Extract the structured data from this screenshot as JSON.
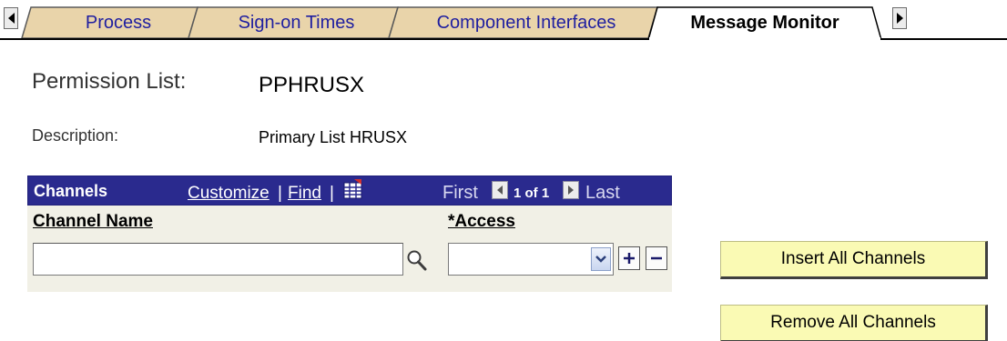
{
  "tabs": [
    {
      "label": "Process",
      "active": false
    },
    {
      "label": "Sign-on Times",
      "active": false
    },
    {
      "label": "Component Interfaces",
      "active": false
    },
    {
      "label": "Message Monitor",
      "active": true
    }
  ],
  "fields": {
    "permission_list_label": "Permission List:",
    "permission_list_value": "PPHRUSX",
    "description_label": "Description:",
    "description_value": "Primary List HRUSX"
  },
  "grid": {
    "title": "Channels",
    "customize_link": "Customize",
    "find_link": "Find",
    "separator": "|",
    "nav_first": "First",
    "nav_count": "1 of 1",
    "nav_last": "Last",
    "columns": [
      "Channel Name",
      "*Access"
    ],
    "row": {
      "channel_name": "",
      "access": ""
    }
  },
  "buttons": {
    "insert_all": "Insert All Channels",
    "remove_all": "Remove All Channels"
  },
  "colors": {
    "grid_header": "#2a2a8e",
    "tab_inactive": "#e9d4aa",
    "button_fill": "#fafab4"
  },
  "icons": [
    "scroll-left-icon",
    "scroll-right-icon",
    "lookup-icon",
    "grid-view-icon",
    "chevron-down-icon",
    "plus-icon",
    "minus-icon"
  ]
}
